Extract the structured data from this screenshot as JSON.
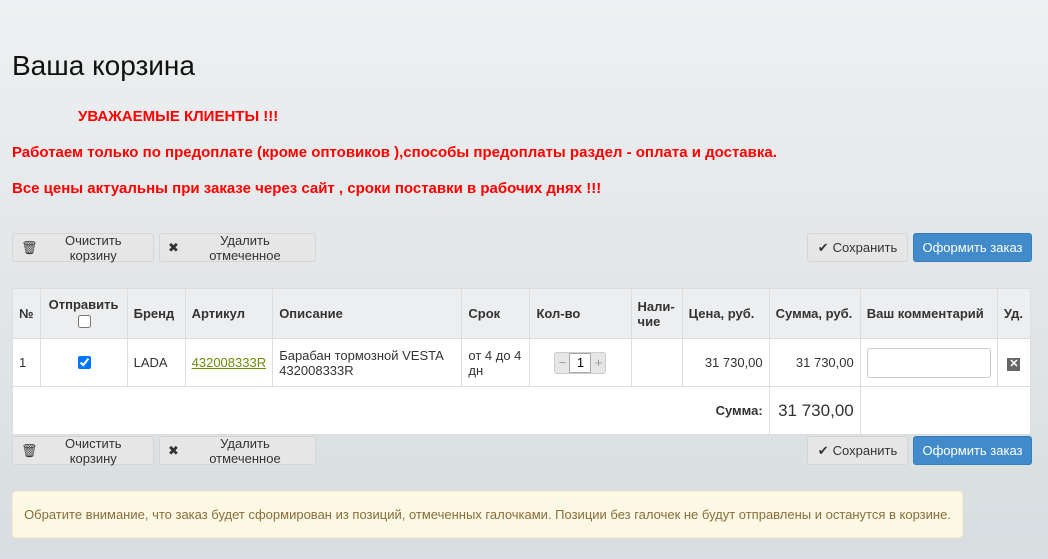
{
  "title": "Ваша корзина",
  "notice_lines": [
    "УВАЖАЕМЫЕ КЛИЕНТЫ !!!",
    "Работаем только по предоплате (кроме оптовиков ),способы предоплаты раздел - оплата и доставка.",
    "Все цены актуальны при заказе через сайт , сроки поставки  в рабочих днях !!!"
  ],
  "buttons": {
    "clear": "Очистить корзину",
    "delete_selected": "Удалить отмеченное",
    "save": "Сохранить",
    "checkout": "Оформить заказ"
  },
  "columns": [
    "№",
    "Отправить",
    "Бренд",
    "Артикул",
    "Описание",
    "Срок",
    "Кол-во",
    "Нали-чие",
    "Цена, руб.",
    "Сумма, руб.",
    "Ваш комментарий",
    "Уд."
  ],
  "rows": [
    {
      "n": "1",
      "checked": true,
      "brand": "LADA",
      "article": "432008333R",
      "description": "Барабан тормозной VESTA 432008333R",
      "term": "от 4 до 4 дн",
      "qty": "1",
      "availability": "",
      "price": "31 730,00",
      "sum": "31 730,00",
      "comment": ""
    }
  ],
  "total_label": "Сумма:",
  "total": "31 730,00",
  "footer_notice": "Обратите внимание, что заказ будет сформирован из позиций, отмеченных галочками. Позиции без галочек не будут отправлены и останутся в корзине.",
  "colors": {
    "accent": "#428bca",
    "warning": "#ff0000"
  }
}
